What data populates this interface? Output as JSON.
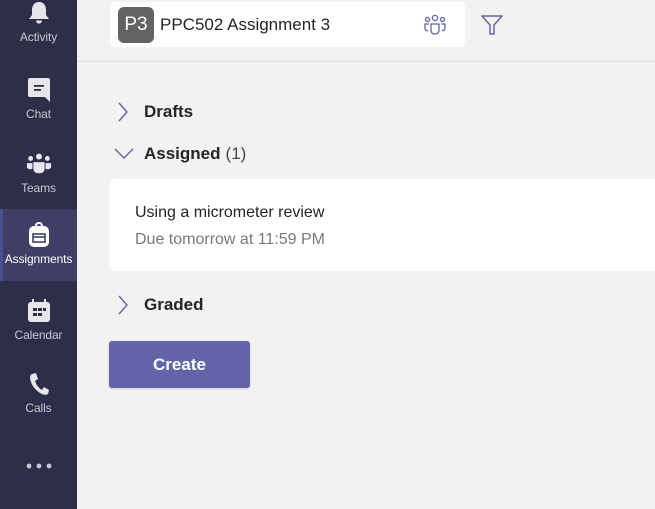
{
  "colors": {
    "rail_bg": "#2e2e48",
    "rail_active_bg": "#3f3f65",
    "accent": "#6264a7",
    "page_bg": "#f3f2f1",
    "avatar_bg": "#636363"
  },
  "rail": {
    "items": [
      {
        "label": "Activity",
        "icon": "bell-icon",
        "active": false
      },
      {
        "label": "Chat",
        "icon": "chat-icon",
        "active": false
      },
      {
        "label": "Teams",
        "icon": "teams-icon",
        "active": false
      },
      {
        "label": "Assignments",
        "icon": "backpack-icon",
        "active": true
      },
      {
        "label": "Calendar",
        "icon": "calendar-icon",
        "active": false
      },
      {
        "label": "Calls",
        "icon": "phone-icon",
        "active": false
      }
    ],
    "more_icon": "more-horizontal-icon"
  },
  "header": {
    "class_avatar": "P3",
    "class_name": "PPC502 Assignment 3",
    "people_icon": "people-icon",
    "filter_icon": "filter-icon"
  },
  "sections": {
    "drafts": {
      "label": "Drafts",
      "expanded": false
    },
    "assigned": {
      "label": "Assigned",
      "count": "(1)",
      "expanded": true,
      "items": [
        {
          "title": "Using a micrometer review",
          "due": "Due tomorrow at 11:59 PM"
        }
      ]
    },
    "graded": {
      "label": "Graded",
      "expanded": false
    }
  },
  "actions": {
    "create_label": "Create"
  }
}
